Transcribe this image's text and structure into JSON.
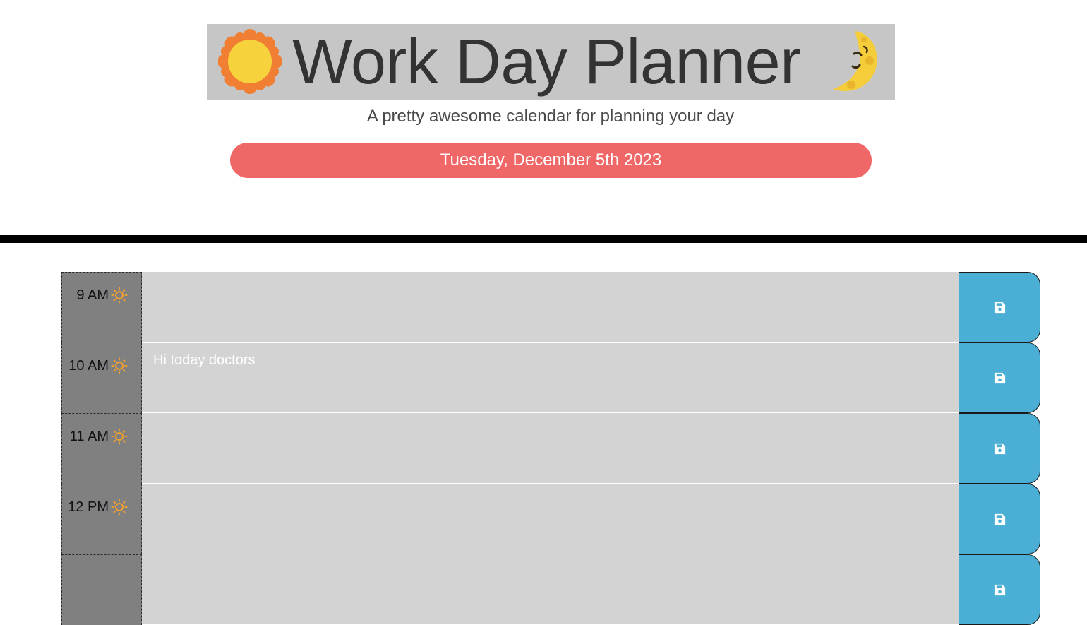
{
  "header": {
    "title": "Work Day Planner",
    "subtitle": "A pretty awesome calendar for planning your day",
    "current_date": "Tuesday, December 5th 2023",
    "left_icon": "sun-icon",
    "right_icon": "moon-icon"
  },
  "colors": {
    "title_bg": "#c6c6c6",
    "date_pill": "#f06767",
    "hour_bg": "#808080",
    "past_row": "#d3d3d3",
    "save_button": "#4aaed5",
    "hour_icon": "#f0a030"
  },
  "rows": [
    {
      "hour": "9 AM",
      "icon": "sun-small-icon",
      "text": "",
      "button_icon": "save-icon"
    },
    {
      "hour": "10 AM",
      "icon": "sun-small-icon",
      "text": "Hi today doctors",
      "button_icon": "save-icon"
    },
    {
      "hour": "11 AM",
      "icon": "sun-small-icon",
      "text": "",
      "button_icon": "save-icon"
    },
    {
      "hour": "12 PM",
      "icon": "sun-small-icon",
      "text": "",
      "button_icon": "save-icon"
    },
    {
      "hour": "",
      "icon": "",
      "text": "",
      "button_icon": "save-icon"
    }
  ]
}
